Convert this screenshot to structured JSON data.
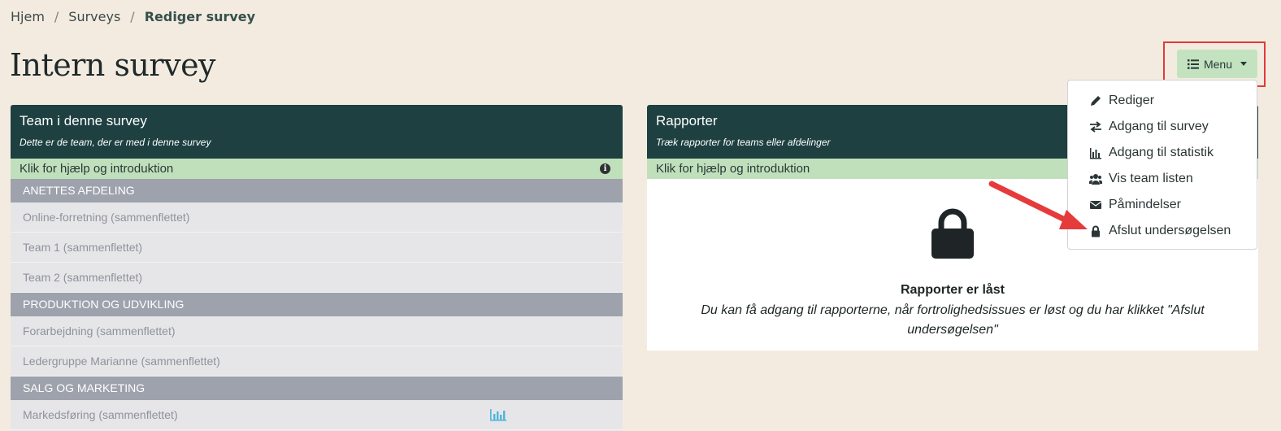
{
  "breadcrumb": {
    "items": [
      "Hjem",
      "Surveys"
    ],
    "current": "Rediger survey"
  },
  "page": {
    "title": "Intern survey"
  },
  "left_panel": {
    "title": "Team i denne survey",
    "subtitle": "Dette er de team, der er med i denne survey",
    "help": "Klik for hjælp og introduktion",
    "groups": [
      {
        "name": "ANETTES AFDELING",
        "teams": [
          "Online-forretning (sammenflettet)",
          "Team 1 (sammenflettet)",
          "Team 2 (sammenflettet)"
        ]
      },
      {
        "name": "PRODUKTION OG UDVIKLING",
        "teams": [
          "Forarbejdning (sammenflettet)",
          "Ledergruppe Marianne (sammenflettet)"
        ]
      },
      {
        "name": "SALG OG MARKETING",
        "teams": [
          "Markedsføring (sammenflettet)"
        ]
      }
    ]
  },
  "right_panel": {
    "title": "Rapporter",
    "subtitle": "Træk rapporter for teams eller afdelinger",
    "help": "Klik for hjælp og introduktion",
    "locked_title": "Rapporter er låst",
    "locked_text": "Du kan få adgang til rapporterne, når fortrolighedsissues er løst og du har klikket \"Afslut undersøgelsen\""
  },
  "menu": {
    "label": "Menu",
    "items": [
      {
        "icon": "pencil-icon",
        "label": "Rediger"
      },
      {
        "icon": "exchange-icon",
        "label": "Adgang til survey"
      },
      {
        "icon": "bar-chart-icon",
        "label": "Adgang til statistik"
      },
      {
        "icon": "users-icon",
        "label": "Vis team listen"
      },
      {
        "icon": "envelope-icon",
        "label": "Påmindelser"
      },
      {
        "icon": "lock-icon",
        "label": "Afslut undersøgelsen"
      }
    ]
  },
  "colors": {
    "background": "#f4ebe0",
    "panel_header": "#1e4041",
    "help_bar": "#bfe0bb",
    "group_header": "#9ea2ad",
    "highlight": "#e23a3a"
  }
}
